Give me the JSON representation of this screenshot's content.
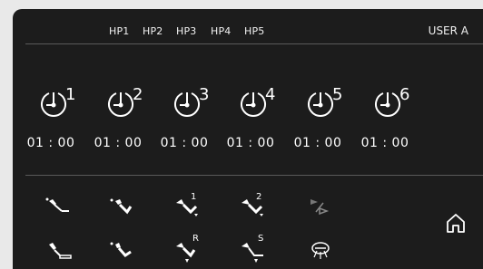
{
  "header": {
    "hp_labels": [
      "HP1",
      "HP2",
      "HP3",
      "HP4",
      "HP5"
    ],
    "user_label": "USER A"
  },
  "timers": [
    {
      "number": "1",
      "time": "01 : 00"
    },
    {
      "number": "2",
      "time": "01 : 00"
    },
    {
      "number": "3",
      "time": "01 : 00"
    },
    {
      "number": "4",
      "time": "01 : 00"
    },
    {
      "number": "5",
      "time": "01 : 00"
    },
    {
      "number": "6",
      "time": "01 : 00"
    }
  ],
  "tools": {
    "row1": [
      {
        "icon": "handpiece-straight-icon",
        "label": ""
      },
      {
        "icon": "handpiece-angle-icon",
        "label": ""
      },
      {
        "icon": "handpiece-angle-1-icon",
        "label": "1"
      },
      {
        "icon": "handpiece-angle-2-icon",
        "label": "2"
      },
      {
        "icon": "forward-reverse-icon",
        "label": ""
      }
    ],
    "row2": [
      {
        "icon": "handpiece-straight-alt-icon",
        "label": ""
      },
      {
        "icon": "handpiece-contra-icon",
        "label": ""
      },
      {
        "icon": "handpiece-reverse-icon",
        "label": "R"
      },
      {
        "icon": "handpiece-s-icon",
        "label": "S"
      },
      {
        "icon": "light-icon",
        "label": ""
      }
    ]
  },
  "home_icon": "home-icon"
}
